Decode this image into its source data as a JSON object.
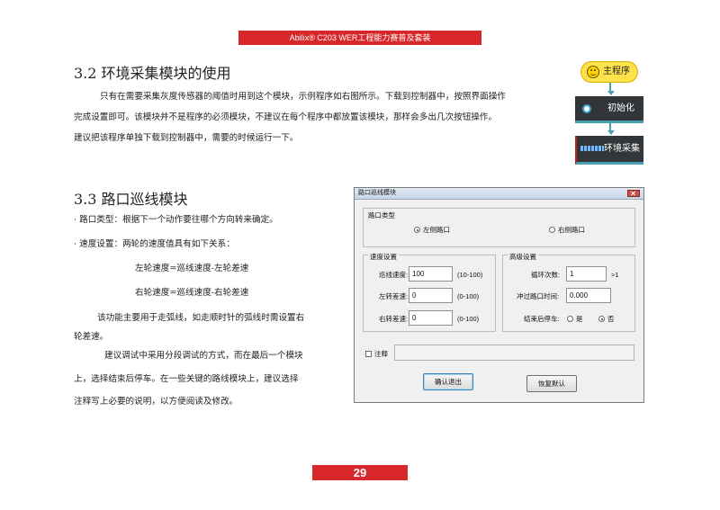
{
  "header": {
    "title": "Abilix® C203 WER工程能力赛普及套装"
  },
  "section_3_2": {
    "heading": "3.2 环境采集模块的使用",
    "paragraph_lines": [
      "只有在需要采集灰度传感器的阈值时用到这个模块，示例程序如右图所示。下载到控制器中，按照界面操作",
      "完成设置即可。该模块并不是程序的必须模块，不建议在每个程序中都放置该模块，那样会多出几次按钮操作。",
      "建议把该程序单独下载到控制器中，需要的时候运行一下。"
    ]
  },
  "flowchart": {
    "main_label": "主程序",
    "init_label": "初始化",
    "env_label": "环境采集",
    "icons": [
      "smiley-icon",
      "circle-icon",
      "sensor-bars-icon"
    ]
  },
  "section_3_3": {
    "heading": "3.3 路口巡线模块",
    "bullet1": "· 路口类型：根据下一个动作要往哪个方向转来确定。",
    "bullet2": "· 速度设置：两轮的速度值具有如下关系：",
    "formula1": "左轮速度=巡线速度-左轮差速",
    "formula2": "右轮速度=巡线速度-右轮差速",
    "note_lines": [
      "该功能主要用于走弧线，如走顺时针的弧线时需设置右",
      "轮差速。"
    ],
    "debug_lines": [
      "建议调试中采用分段调试的方式，而在最后一个模块",
      "上，选择结束后停车。在一些关键的路线模块上，建议选择",
      "注释写上必要的说明，以方便阅读及修改。"
    ]
  },
  "dialog": {
    "title": "路口巡线模块",
    "junction_group": "路口类型",
    "left_option": "左侧路口",
    "right_option": "右侧路口",
    "speed_group": "速度设置",
    "line_speed_label": "巡线速度:",
    "line_speed_value": "100",
    "line_speed_range": "(10-100)",
    "left_diff_label": "左转差速:",
    "left_diff_value": "0",
    "left_diff_range": "(0-100)",
    "right_diff_label": "右转差速:",
    "right_diff_value": "0",
    "right_diff_range": "(0-100)",
    "advanced_group": "高级设置",
    "loop_label": "循环次数:",
    "loop_value": "1",
    "loop_hint": ">1",
    "rush_label": "冲过路口时间:",
    "rush_value": "0.000",
    "stop_label": "结束后停车:",
    "yes_option": "是",
    "no_option": "否",
    "comment_label": "注释",
    "comment_value": "",
    "confirm_button": "确认退出",
    "reset_button": "恢复默认",
    "selected_junction": "左侧路口",
    "selected_stop": "否"
  },
  "page": {
    "number": "29"
  },
  "colors": {
    "accent_red": "#d7272b",
    "block_dark": "#333639",
    "block_teal": "#4aa0b0",
    "main_yellow": "#ffe24a"
  }
}
